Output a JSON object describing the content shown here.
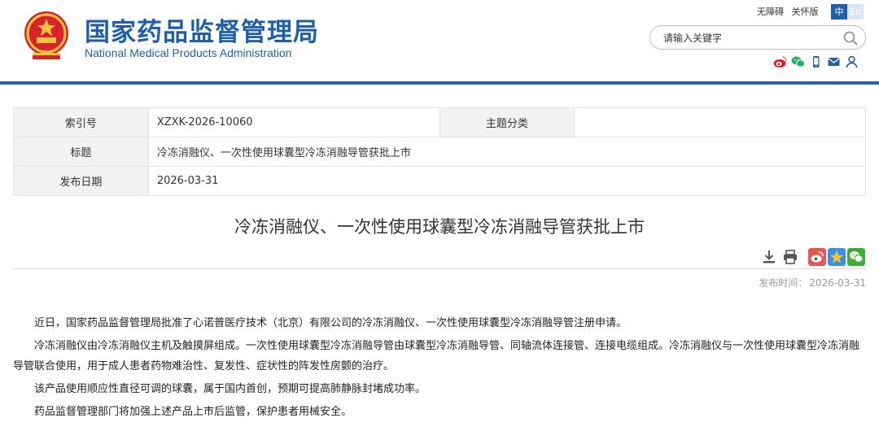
{
  "header": {
    "title_cn": "国家药品监督管理局",
    "title_en": "National Medical Products Administration",
    "links": [
      "无障碍",
      "关怀版"
    ],
    "lang": [
      "中",
      "En"
    ],
    "search_placeholder": "请输入关键字",
    "social_icons": [
      "weibo-icon",
      "wechat-icon",
      "mobile-icon",
      "mail-icon",
      "user-icon"
    ],
    "accent": "#1f5fa8"
  },
  "meta": {
    "index_label": "索引号",
    "index_value": "XZXK-2026-10060",
    "topic_label": "主题分类",
    "topic_value": "",
    "title_label": "标题",
    "title_value": "冷冻消融仪、一次性使用球囊型冷冻消融导管获批上市",
    "date_label": "发布日期",
    "date_value": "2026-03-31"
  },
  "article": {
    "title": "冷冻消融仪、一次性使用球囊型冷冻消融导管获批上市",
    "pub_label": "发布时间：",
    "pub_value": "2026-03-31",
    "paragraphs": [
      "近日，国家药品监督管理局批准了心诺普医疗技术（北京）有限公司的冷冻消融仪、一次性使用球囊型冷冻消融导管注册申请。",
      "冷冻消融仪由冷冻消融仪主机及触摸屏组成。一次性使用球囊型冷冻消融导管由球囊型冷冻消融导管、同轴流体连接管、连接电缆组成。冷冻消融仪与一次性使用球囊型冷冻消融导管联合使用，用于成人患者药物难治性、复发性、症状性的阵发性房颤的治疗。",
      "该产品使用顺应性直径可调的球囊，属于国内首创，预期可提高肺静脉封堵成功率。",
      "药品监督管理部门将加强上述产品上市后监管，保护患者用械安全。"
    ]
  },
  "tools": [
    "download-icon",
    "print-icon"
  ],
  "share": [
    "share-weibo-icon",
    "share-qzone-icon",
    "share-wechat-icon"
  ]
}
